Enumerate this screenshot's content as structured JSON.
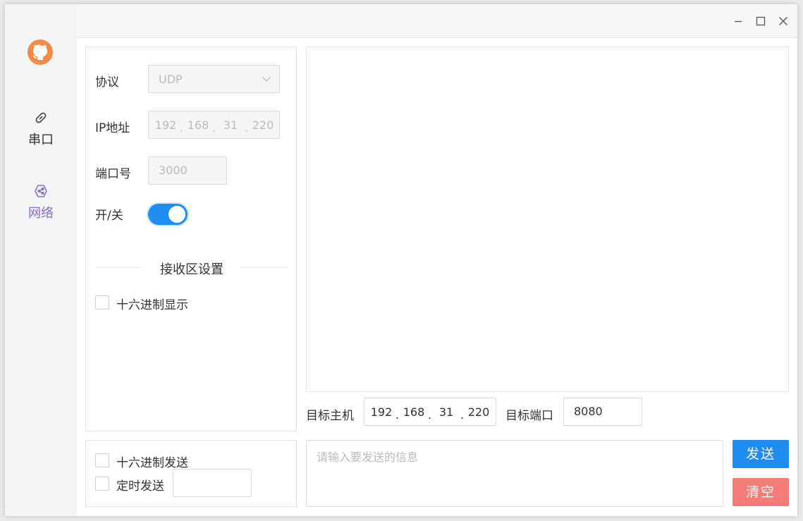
{
  "sidebar": {
    "logo_icon": "github-icon",
    "items": [
      {
        "label": "串口",
        "icon": "link-icon",
        "active": false
      },
      {
        "label": "网络",
        "icon": "network-icon",
        "active": true
      }
    ]
  },
  "titlebar": {
    "buttons": [
      "minimize-icon",
      "maximize-icon",
      "close-icon"
    ]
  },
  "settings": {
    "protocol_label": "协议",
    "protocol_value": "UDP",
    "ip_label": "IP地址",
    "ip": [
      "192",
      "168",
      "31",
      "220"
    ],
    "port_label": "端口号",
    "port_value": "3000",
    "switch_label": "开/关",
    "switch_on": true,
    "receive_section_title": "接收区设置",
    "hex_display_label": "十六进制显示"
  },
  "target": {
    "host_label": "目标主机",
    "host_ip": [
      "192",
      "168",
      "31",
      "220"
    ],
    "port_label": "目标端口",
    "port_value": "8080"
  },
  "send_options": {
    "hex_send_label": "十六进制发送",
    "timed_send_label": "定时发送",
    "timed_interval_value": ""
  },
  "send": {
    "placeholder": "请输入要发送的信息",
    "send_button": "发送",
    "clear_button": "清空"
  },
  "colors": {
    "primary": "#1f8cf0",
    "danger": "#f57b7b",
    "active_nav": "#8a6cc9",
    "logo": "#f28a4a"
  }
}
